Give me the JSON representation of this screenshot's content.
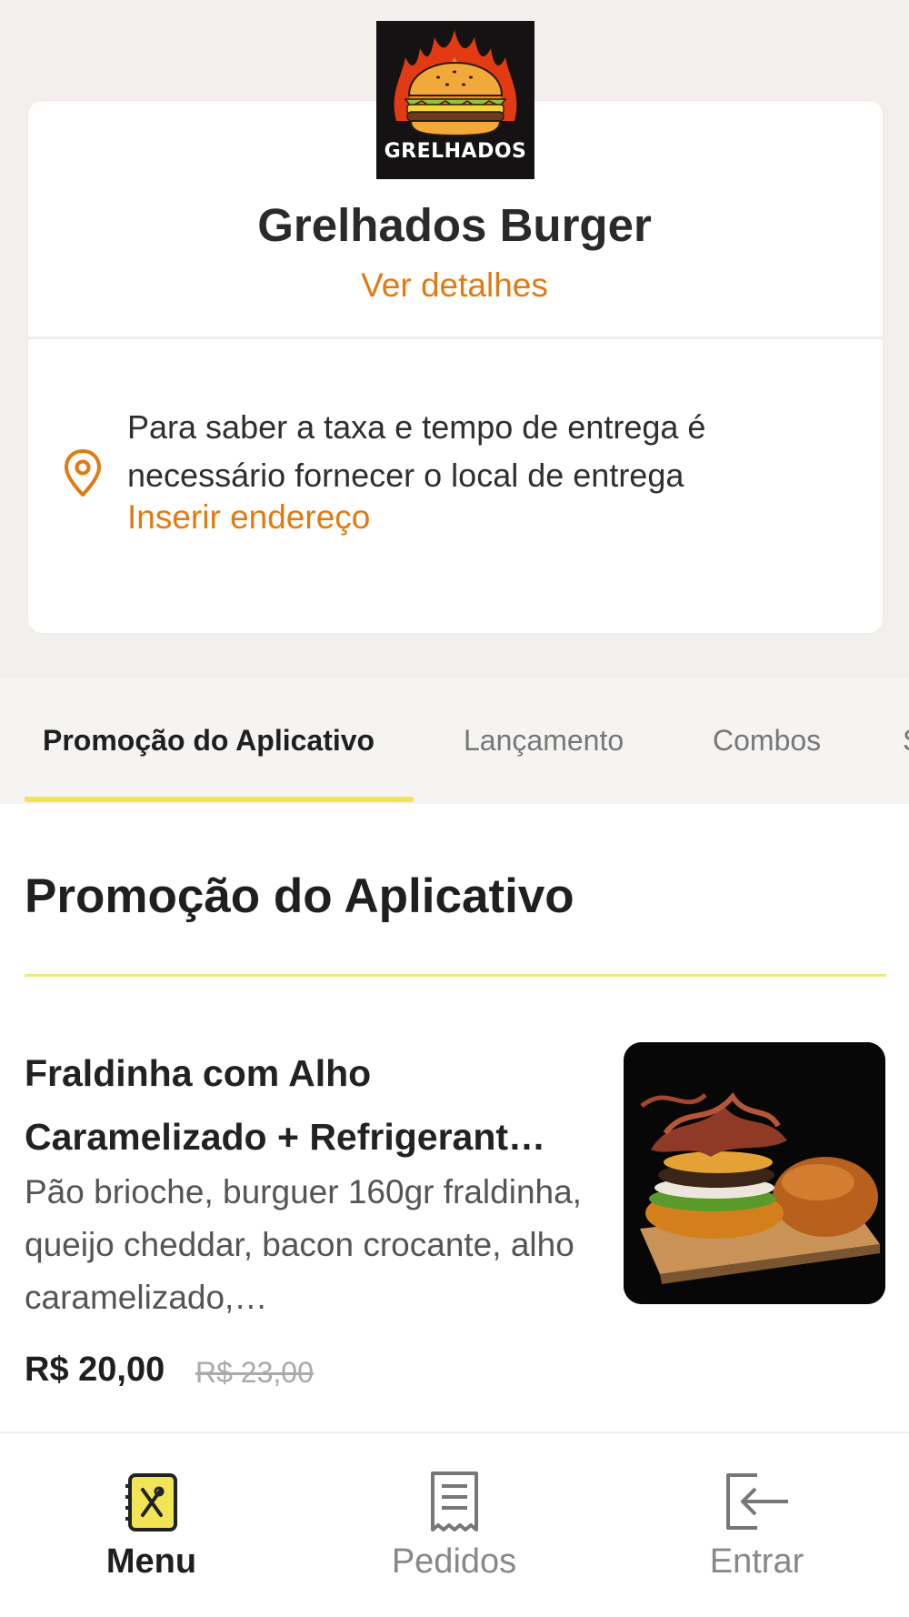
{
  "store": {
    "logo_text": "GRELHADOS",
    "name": "Grelhados Burger",
    "details_link": "Ver detalhes"
  },
  "delivery": {
    "message": "Para saber a taxa e tempo de entrega é necessário fornecer o local de entrega",
    "address_link": "Inserir endereço"
  },
  "tabs": [
    {
      "label": "Promoção do Aplicativo",
      "active": true
    },
    {
      "label": "Lançamento",
      "active": false
    },
    {
      "label": "Combos",
      "active": false
    },
    {
      "label": "S",
      "active": false
    }
  ],
  "section": {
    "title": "Promoção do Aplicativo"
  },
  "product": {
    "name": "Fraldinha com Alho Caramelizado + Refrigerant…",
    "description": "Pão brioche, burguer 160gr fraldinha, queijo cheddar, bacon crocante, alho caramelizado,…",
    "price": "R$ 20,00",
    "old_price": "R$ 23,00"
  },
  "bottom_nav": [
    {
      "label": "Menu",
      "icon": "menu-book-icon",
      "active": true
    },
    {
      "label": "Pedidos",
      "icon": "receipt-icon",
      "active": false
    },
    {
      "label": "Entrar",
      "icon": "login-icon",
      "active": false
    }
  ],
  "colors": {
    "accent_orange": "#e07b14",
    "accent_yellow": "#f1e455",
    "background_top": "#f2f0ed"
  }
}
